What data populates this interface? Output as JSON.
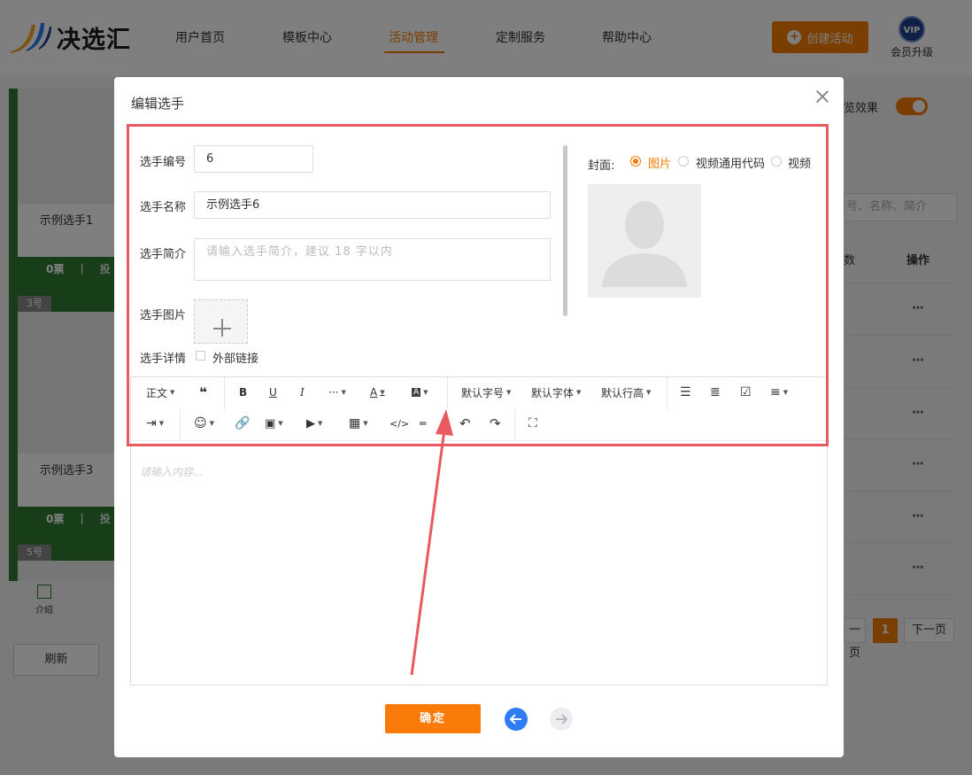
{
  "header": {
    "logo_text": "决选汇",
    "nav": [
      "用户首页",
      "模板中心",
      "活动管理",
      "定制服务",
      "帮助中心"
    ],
    "active_nav": "活动管理",
    "create_button": "创建活动",
    "vip_badge": "VIP",
    "vip_label": "会员升级"
  },
  "background": {
    "cards": [
      {
        "name": "示例选手1",
        "votes": "0票",
        "action": "投"
      },
      {
        "name": "示例选手3",
        "votes": "0票",
        "action": "投"
      }
    ],
    "tags": [
      "3号",
      "5号"
    ],
    "intro_label": "介绍",
    "refresh_button": "刷新",
    "preview_label": "览效果",
    "search_placeholder": "号、名称、简介",
    "col_header": "操作",
    "col_header_left": "数",
    "row_action": "···",
    "pager": {
      "prev": "一页",
      "current": "1",
      "next": "下一页"
    }
  },
  "dialog": {
    "title": "编辑选手",
    "fields": {
      "number_label": "选手编号",
      "number_value": "6",
      "name_label": "选手名称",
      "name_value": "示例选手6",
      "intro_label": "选手简介",
      "intro_placeholder": "请输入选手简介，建议 18 字以内",
      "image_label": "选手图片",
      "detail_label": "选手详情",
      "external_link_label": "外部链接"
    },
    "cover": {
      "label": "封面:",
      "options": [
        "图片",
        "视频通用代码",
        "视频"
      ],
      "selected": "图片"
    },
    "toolbar_row1": {
      "heading": "正文",
      "font_size": "默认字号",
      "font_family": "默认字体",
      "line_height": "默认行高"
    },
    "editor_placeholder": "请输入内容...",
    "confirm_button": "确定"
  },
  "colors": {
    "accent": "#f57c00",
    "highlight_box": "#e85a5f",
    "nav_prev": "#2d7cf6",
    "card_green": "#2e7d32"
  }
}
